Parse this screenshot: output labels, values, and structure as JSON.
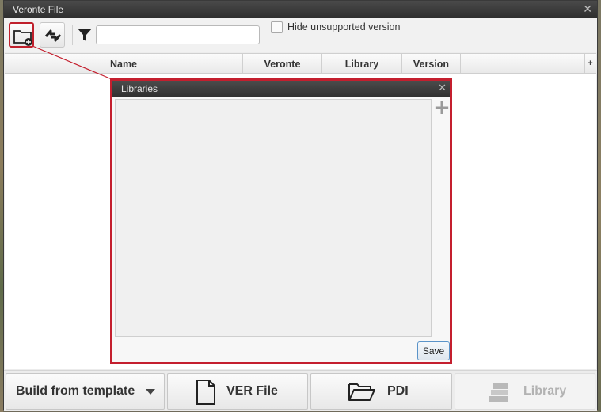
{
  "window": {
    "title": "Veronte File",
    "close_glyph": "✕"
  },
  "toolbar": {
    "add_folder_icon": "folder-add-icon",
    "sync_icon": "sync-arrows-icon",
    "filter_icon": "funnel-icon",
    "filter_value": "",
    "hide_unsupported_label": "Hide unsupported version",
    "hide_unsupported_checked": false
  },
  "table": {
    "columns": [
      "Name",
      "Veronte",
      "Library",
      "Version"
    ],
    "add_column_glyph": "+",
    "rows": []
  },
  "libraries_dialog": {
    "title": "Libraries",
    "close_glyph": "✕",
    "add_glyph": "+",
    "items": [],
    "save_label": "Save"
  },
  "bottom_bar": {
    "build_label": "Build from template",
    "ver_file_label": "VER File",
    "pdi_label": "PDI",
    "library_label": "Library",
    "library_disabled": true
  },
  "colors": {
    "highlight": "#c41f2e",
    "titlebar": "#333333",
    "focus_border": "#5a93c8"
  }
}
